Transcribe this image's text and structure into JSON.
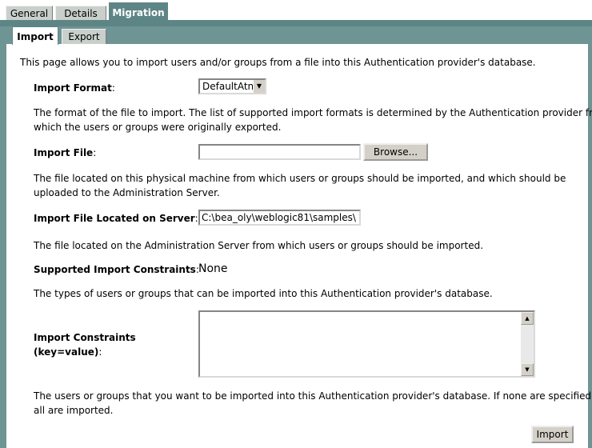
{
  "top_tabs": [
    {
      "label": "General"
    },
    {
      "label": "Details"
    },
    {
      "label": "Migration"
    }
  ],
  "sub_tabs": [
    {
      "label": "Import"
    },
    {
      "label": "Export"
    }
  ],
  "intro": "This page allows you to import users and/or groups from a file into this Authentication provider's database.",
  "import_format": {
    "label": "Import Format",
    "colon": ":",
    "selected": "DefaultAtn",
    "help1": "The format of the file to import. The list of supported import formats is determined by the Authentication provider from",
    "help2": "which the users or groups were originally exported."
  },
  "import_file": {
    "label": "Import File",
    "colon": ":",
    "value": "",
    "browse_label": "Browse...",
    "help1": "The file located on this physical machine from which users or groups should be imported, and which should be",
    "help2": "uploaded to the Administration Server."
  },
  "import_file_server": {
    "label": "Import File Located on Server",
    "colon": ":",
    "value": "C:\\bea_oly\\weblogic81\\samples\\",
    "help": "The file located on the Administration Server from which users or groups should be imported."
  },
  "supported_constraints": {
    "label": "Supported Import Constraints",
    "colon": ":",
    "value": "None",
    "help": "The types of users or groups that can be imported into this Authentication provider's database."
  },
  "import_constraints": {
    "label1": "Import Constraints",
    "label2": "(key=value)",
    "colon": ":",
    "help1": "The users or groups that you want to be imported into this Authentication provider's database. If none are specified,",
    "help2": "all are imported."
  },
  "import_button_label": "Import"
}
